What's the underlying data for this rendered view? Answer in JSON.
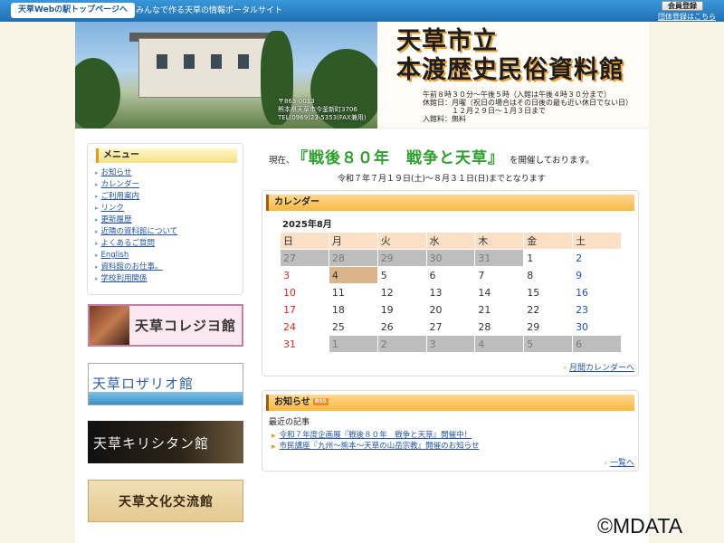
{
  "topbar": {
    "portal_button": "天草Webの駅トップページへ",
    "tagline": "みんなで作る天草の情報ポータルサイト",
    "member_button": "会員登録",
    "group_link": "団体登録はこちら"
  },
  "banner": {
    "title_line1": "天草市立",
    "title_line2": "本渡歴史民俗資料館",
    "photo_address": [
      "〒863-0013",
      "熊本県天草市今釜新町3706",
      "TEL(0969)23-5353(FAX兼用)"
    ],
    "info_lines": [
      "午前８時３０分～午後５時（入館は午後４時３０分まで）",
      "休館日：月曜（祝日の場合はその日後の最も近い休日でない日）",
      "　　　　１２月２９日～１月３日まで",
      "入館料：無料"
    ]
  },
  "sidebar": {
    "menu_title": "メニュー",
    "items": [
      {
        "label": "お知らせ"
      },
      {
        "label": "カレンダー"
      },
      {
        "label": "ご利用案内"
      },
      {
        "label": "リンク"
      },
      {
        "label": "更新履歴"
      },
      {
        "label": "近隣の資料館について"
      },
      {
        "label": "よくあるご質問"
      },
      {
        "label": "English"
      },
      {
        "label": "資料館のお仕事。"
      },
      {
        "label": "学校利用関係"
      }
    ],
    "banners": [
      "天草コレジヨ館",
      "天草ロザリオ館",
      "天草キリシタン館",
      "天草文化交流館"
    ]
  },
  "main": {
    "exhibit_prefix": "現在、",
    "exhibit_name": "『戦後８０年　戦争と天草』",
    "exhibit_suffix": "を開催しております。",
    "exhibit_period": "令和７年７月１９日(土)～８月３１日(日)までとなります"
  },
  "calendar": {
    "heading": "カレンダー",
    "month_label": "2025年8月",
    "weekdays": [
      "日",
      "月",
      "火",
      "水",
      "木",
      "金",
      "土"
    ],
    "weeks": [
      [
        {
          "d": "27",
          "o": 1
        },
        {
          "d": "28",
          "o": 1
        },
        {
          "d": "29",
          "o": 1
        },
        {
          "d": "30",
          "o": 1
        },
        {
          "d": "31",
          "o": 1
        },
        {
          "d": "1"
        },
        {
          "d": "2"
        }
      ],
      [
        {
          "d": "3"
        },
        {
          "d": "4",
          "t": 1
        },
        {
          "d": "5"
        },
        {
          "d": "6"
        },
        {
          "d": "7"
        },
        {
          "d": "8"
        },
        {
          "d": "9"
        }
      ],
      [
        {
          "d": "10"
        },
        {
          "d": "11"
        },
        {
          "d": "12"
        },
        {
          "d": "13"
        },
        {
          "d": "14"
        },
        {
          "d": "15"
        },
        {
          "d": "16"
        }
      ],
      [
        {
          "d": "17"
        },
        {
          "d": "18"
        },
        {
          "d": "19"
        },
        {
          "d": "20"
        },
        {
          "d": "21"
        },
        {
          "d": "22"
        },
        {
          "d": "23"
        }
      ],
      [
        {
          "d": "24"
        },
        {
          "d": "25"
        },
        {
          "d": "26"
        },
        {
          "d": "27"
        },
        {
          "d": "28"
        },
        {
          "d": "29"
        },
        {
          "d": "30"
        }
      ],
      [
        {
          "d": "31"
        },
        {
          "d": "1",
          "o": 1
        },
        {
          "d": "2",
          "o": 1
        },
        {
          "d": "3",
          "o": 1
        },
        {
          "d": "4",
          "o": 1
        },
        {
          "d": "5",
          "o": 1
        },
        {
          "d": "6",
          "o": 1
        }
      ]
    ],
    "more_link": "月間カレンダーへ"
  },
  "news": {
    "heading": "お知らせ",
    "rss_label": "RSS",
    "subheading": "最近の記事",
    "items": [
      {
        "title": "令和７年度企画展『戦後８０年　戦争と天草』開催中！"
      },
      {
        "title": "市民講座『九州～熊本～天草の山岳宗教』開催のお知らせ"
      }
    ],
    "more_link": "一覧へ"
  },
  "watermark": "©MDATA",
  "colors": {
    "topbar": "#1f6fb2",
    "exhibit_accent": "#2ca02c",
    "panel_head": "#f7b941",
    "sunday": "#e0281e",
    "saturday": "#2450c8",
    "link": "#2354a8"
  }
}
